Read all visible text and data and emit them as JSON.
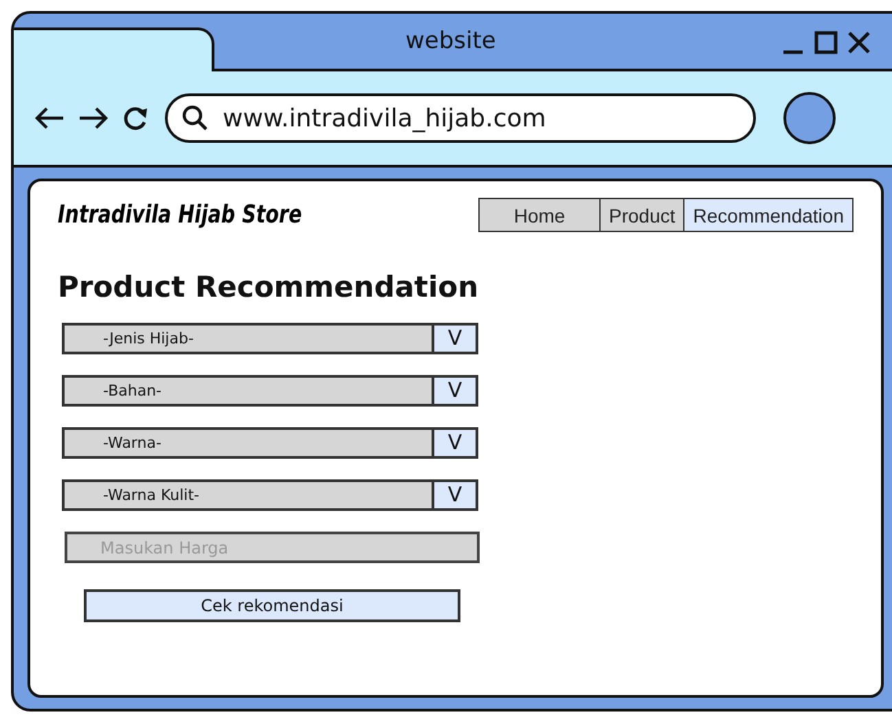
{
  "window": {
    "title": "website"
  },
  "address_bar": {
    "url": "www.intradivila_hijab.com"
  },
  "site": {
    "brand": "Intradivila Hijab Store",
    "nav": [
      {
        "label": "Home",
        "selected": false
      },
      {
        "label": "Product",
        "selected": false
      },
      {
        "label": "Recommendation",
        "selected": true
      }
    ]
  },
  "page_title": "Product Recommendation",
  "dropdowns": [
    {
      "label": "-Jenis Hijab-",
      "toggle": "V"
    },
    {
      "label": "-Bahan-",
      "toggle": "V"
    },
    {
      "label": "-Warna-",
      "toggle": "V"
    },
    {
      "label": "-Warna Kulit-",
      "toggle": "V"
    }
  ],
  "price_field": {
    "placeholder": "Masukan Harga"
  },
  "submit_button": "Cek rekomendasi"
}
